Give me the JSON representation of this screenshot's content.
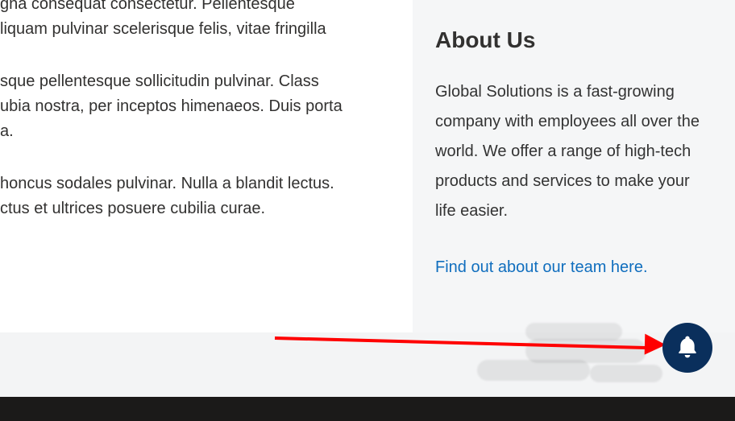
{
  "main": {
    "p1": "gna consequat consectetur. Pellentesque",
    "p2": "liquam pulvinar scelerisque felis, vitae fringilla",
    "p3": "sque pellentesque sollicitudin pulvinar. Class",
    "p4": "ubia nostra, per inceptos himenaeos. Duis porta",
    "p5": "a.",
    "p6": "honcus sodales pulvinar. Nulla a blandit lectus.",
    "p7": "ctus et ultrices posuere cubilia curae."
  },
  "sidebar": {
    "heading": "About Us",
    "body": "Global Solutions is a fast-growing company with employees all over the world. We offer a range of high-tech products and services to make your life easier.",
    "link_text": "Find out about our team here."
  },
  "annotation": {
    "arrow_target": "notifications-bell-button"
  }
}
